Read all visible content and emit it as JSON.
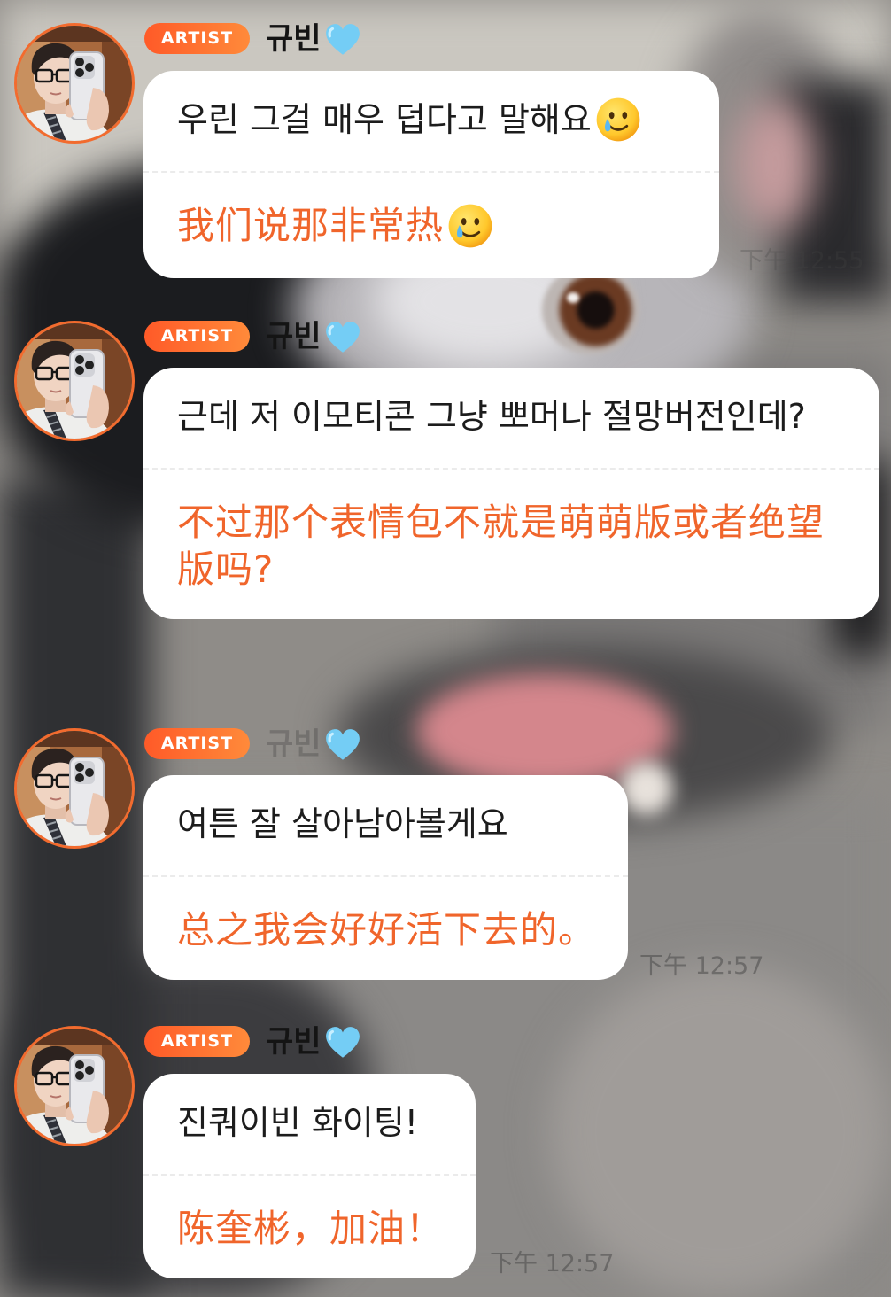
{
  "messages": [
    {
      "badge": "ARTIST",
      "sender": "규빈",
      "sender_icon": "blue-heart-icon",
      "korean": "우린 그걸 매우 덥다고 말해요",
      "korean_emoji": "smiling-face-with-tear-icon",
      "chinese": "我们说那非常热",
      "chinese_emoji": "smiling-face-with-tear-icon",
      "time": "下午 12:55"
    },
    {
      "badge": "ARTIST",
      "sender": "규빈",
      "sender_icon": "blue-heart-icon",
      "korean": "근데 저 이모티콘 그냥 뽀머나 절망버전인데?",
      "chinese": "不过那个表情包不就是萌萌版或者绝望版吗?"
    },
    {
      "badge": "ARTIST",
      "sender": "규빈",
      "sender_icon": "blue-heart-icon",
      "korean": "여튼 잘 살아남아볼게요",
      "chinese": "总之我会好好活下去的。",
      "time": "下午 12:57"
    },
    {
      "badge": "ARTIST",
      "sender": "규빈",
      "sender_icon": "blue-heart-icon",
      "korean": "진쿼이빈 화이팅!",
      "chinese": "陈奎彬，加油！",
      "time": "下午 12:57"
    }
  ],
  "colors": {
    "badge": "#ff6a30",
    "translation_text": "#f0652b",
    "avatar_ring": "#f26b2e",
    "bubble": "#ffffff",
    "heart": "#74cdf5"
  }
}
